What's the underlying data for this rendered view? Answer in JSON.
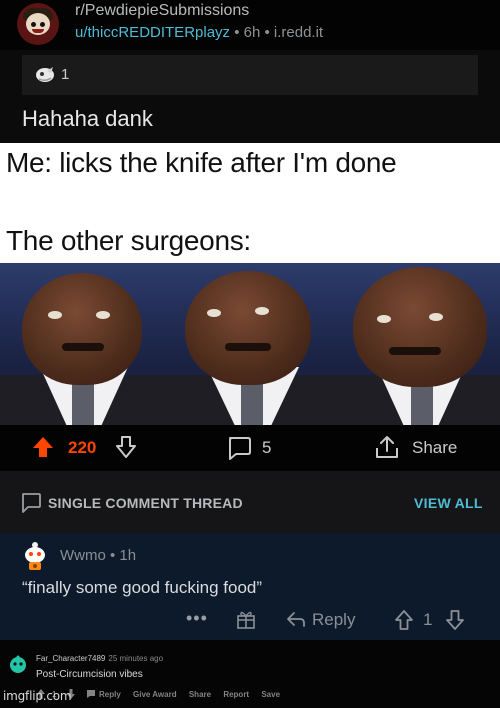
{
  "header": {
    "subreddit": "r/PewdiepieSubmissions",
    "username": "u/thiccREDDITERplayz",
    "meta_rest": " • 6h • i.redd.it"
  },
  "awards": {
    "icon": "rocket-award-icon",
    "count": "1"
  },
  "post": {
    "title": "Hahaha dank"
  },
  "meme": {
    "line1": "Me: licks the knife after I'm done",
    "line2": "The other surgeons:"
  },
  "actions": {
    "upvotes": "220",
    "comments": "5",
    "share_label": "Share",
    "upvote_color": "#ff4500"
  },
  "thread": {
    "label": "SINGLE COMMENT THREAD",
    "view_all": "VIEW ALL"
  },
  "comment": {
    "author": "Wwmo • 1h",
    "body": "“finally some good fucking food”",
    "more": "•••",
    "reply_label": "Reply",
    "score": "1"
  },
  "old_comment": {
    "author": "Far_Character7489",
    "time": "25 minutes ago",
    "body": "Post-Circumcision vibes",
    "score": "1",
    "actions": [
      "Reply",
      "Give Award",
      "Share",
      "Report",
      "Save"
    ]
  },
  "watermark": "imgflip.com",
  "colors": {
    "accent_blue": "#4fbcd4",
    "thread_bg": "#0d1a2c"
  }
}
